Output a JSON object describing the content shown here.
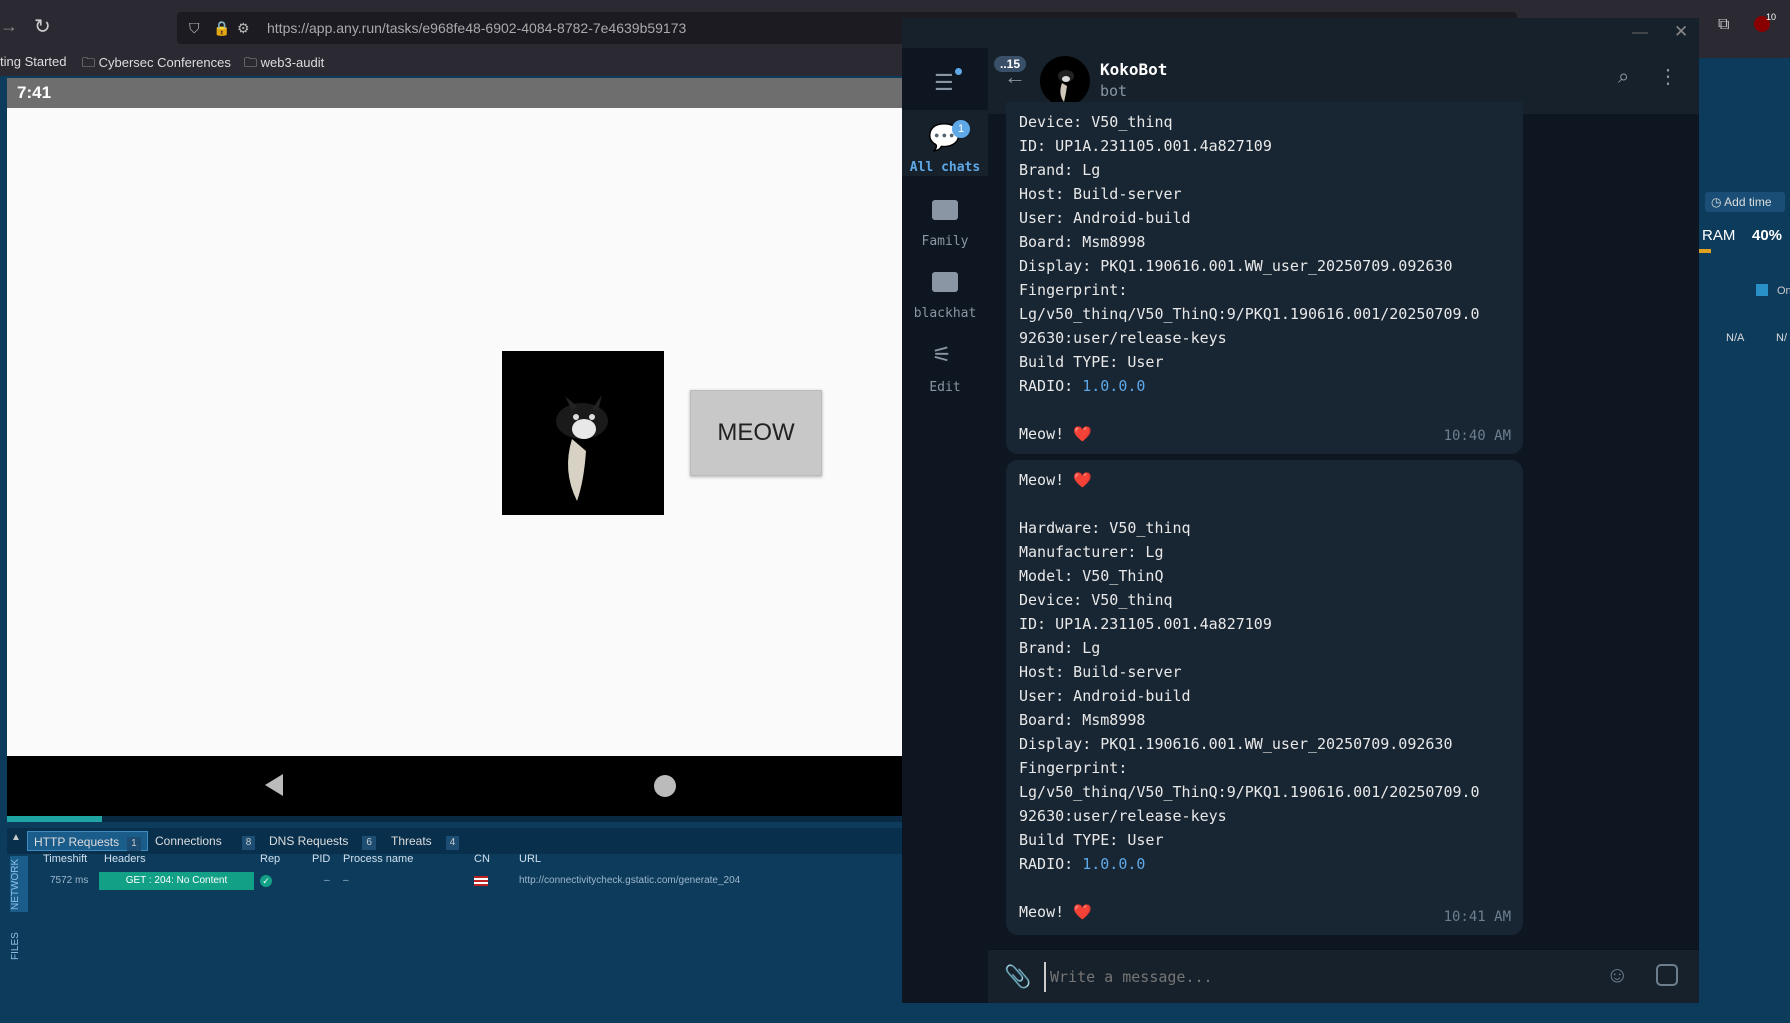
{
  "browser": {
    "url": "https://app.any.run/tasks/e968fe48-6902-4084-8782-7e4639b59173",
    "bookmarks": [
      "ting Started",
      "Cybersec Conferences",
      "web3-audit"
    ],
    "notif_count": "10"
  },
  "emulator": {
    "time": "7:41",
    "meow_label": "MEOW"
  },
  "bottom_panel": {
    "tabs": [
      {
        "label": "HTTP Requests",
        "count": "1"
      },
      {
        "label": "Connections",
        "count": "8"
      },
      {
        "label": "DNS Requests",
        "count": "6"
      },
      {
        "label": "Threats",
        "count": "4"
      }
    ],
    "side_labels": [
      "NETWORK",
      "FILES"
    ],
    "headers": [
      "Timeshift",
      "Headers",
      "Rep",
      "PID",
      "Process name",
      "CN",
      "URL"
    ],
    "row": {
      "timeshift": "7572 ms",
      "method_status": "GET : 204: No Content",
      "pid": "–",
      "process": "–",
      "url": "http://connectivitycheck.gstatic.com/generate_204"
    }
  },
  "right_panel": {
    "add_time": "Add time",
    "ram_label": "RAM",
    "ram_value": "40%",
    "na1": "N/A",
    "na2": "N/",
    "cut": "On"
  },
  "telegram": {
    "unread_badge": "..15",
    "chat_name": "KokoBot",
    "chat_status": "bot",
    "folders": [
      {
        "label": "All chats",
        "badge": "1"
      },
      {
        "label": "Family"
      },
      {
        "label": "blackhat"
      },
      {
        "label": "Edit"
      }
    ],
    "message1": {
      "text": "Device: V50_thinq\nID: UP1A.231105.001.4a827109\nBrand: Lg\nHost: Build-server\nUser: Android-build\nBoard: Msm8998\nDisplay: PKQ1.190616.001.WW_user_20250709.092630\nFingerprint:\nLg/v50_thinq/V50_ThinQ:9/PKQ1.190616.001/20250709.0\n92630:user/release-keys\nBuild TYPE: User\nRADIO: ",
      "radio": "1.0.0.0",
      "meow": "Meow! ",
      "time": "10:40 AM"
    },
    "message2": {
      "meow_top": "Meow! ",
      "text": "Hardware: V50_thinq\nManufacturer: Lg\nModel: V50_ThinQ\nDevice: V50_thinq\nID: UP1A.231105.001.4a827109\nBrand: Lg\nHost: Build-server\nUser: Android-build\nBoard: Msm8998\nDisplay: PKQ1.190616.001.WW_user_20250709.092630\nFingerprint:\nLg/v50_thinq/V50_ThinQ:9/PKQ1.190616.001/20250709.0\n92630:user/release-keys\nBuild TYPE: User\nRADIO: ",
      "radio": "1.0.0.0",
      "meow": "Meow! ",
      "time": "10:41 AM"
    },
    "heart": "❤️",
    "input_placeholder": "Write a message..."
  },
  "colors": {
    "accent": "#5ea8e8",
    "heart": "#e0262f",
    "teal": "#12a087"
  }
}
